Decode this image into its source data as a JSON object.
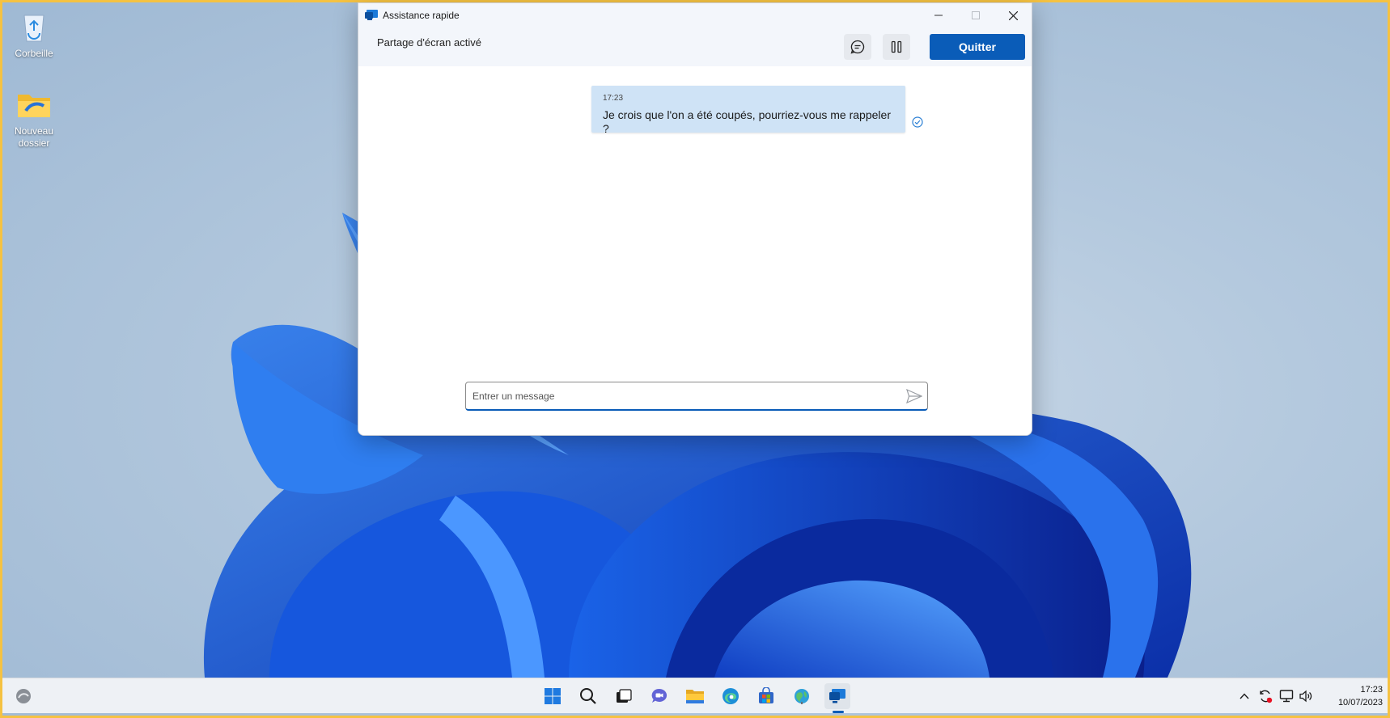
{
  "desktop": {
    "icons": [
      {
        "label": "Corbeille"
      },
      {
        "label": "Nouveau dossier"
      }
    ]
  },
  "window": {
    "title": "Assistance rapide",
    "share_status": "Partage d'écran activé",
    "quit_label": "Quitter",
    "message": {
      "time": "17:23",
      "text": "Je crois que l'on a été coupés, pourriez-vous me rappeler ?"
    },
    "input": {
      "value": "",
      "placeholder": "Entrer un message"
    }
  },
  "taskbar": {
    "apps": [
      "start-icon",
      "search-icon",
      "task-view-icon",
      "teams-chat-icon",
      "file-explorer-icon",
      "edge-icon",
      "store-icon",
      "weather-icon",
      "quick-assist-icon"
    ],
    "clock": {
      "time": "17:23",
      "date": "10/07/2023"
    }
  },
  "colors": {
    "accent": "#0a5cb8",
    "bubble": "#cfe3f6"
  }
}
